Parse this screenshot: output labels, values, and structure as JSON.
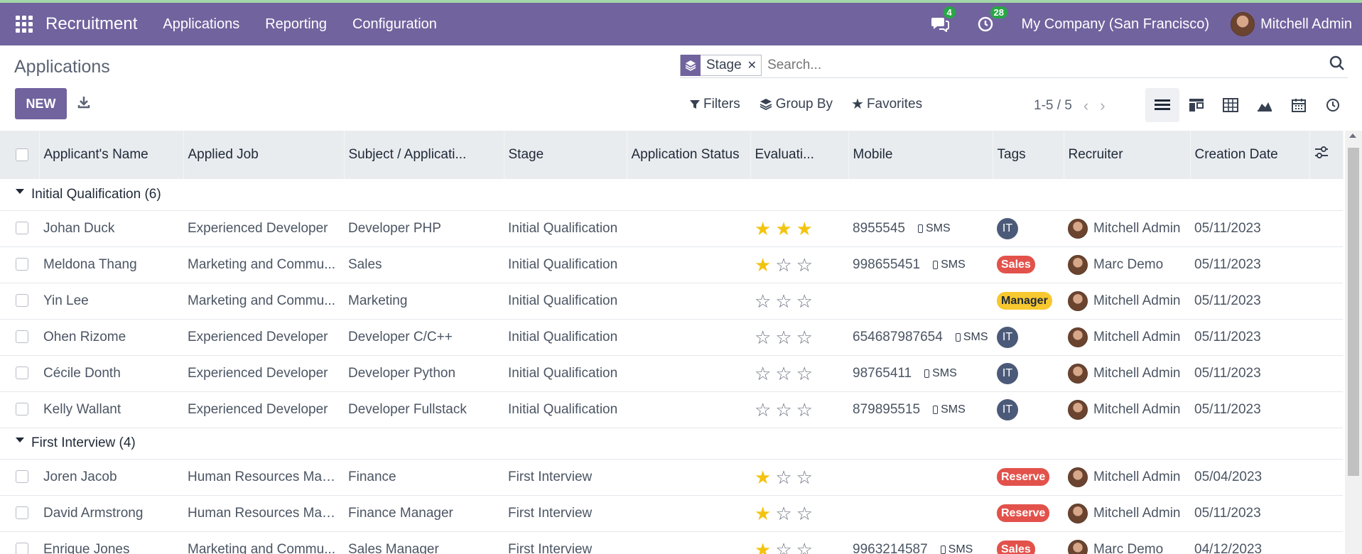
{
  "navbar": {
    "app_title": "Recruitment",
    "menus": [
      "Applications",
      "Reporting",
      "Configuration"
    ],
    "messages_count": "4",
    "activities_count": "28",
    "company": "My Company (San Francisco)",
    "user": "Mitchell Admin",
    "bg_color": "#71639e"
  },
  "control": {
    "title": "Applications",
    "new_label": "NEW",
    "facet_label": "Stage",
    "search_placeholder": "Search...",
    "filters_label": "Filters",
    "groupby_label": "Group By",
    "favorites_label": "Favorites",
    "pager": "1-5 / 5"
  },
  "table": {
    "headers": [
      "Applicant's Name",
      "Applied Job",
      "Subject / Applicati...",
      "Stage",
      "Application Status",
      "Evaluati...",
      "Mobile",
      "Tags",
      "Recruiter",
      "Creation Date"
    ],
    "groups": [
      {
        "label": "Initial Qualification (6)",
        "rows": [
          {
            "name": "Johan Duck",
            "job": "Experienced Developer",
            "subject": "Developer PHP",
            "stage": "Initial Qualification",
            "status": "",
            "stars": 3,
            "mobile": "8955545",
            "sms": "SMS",
            "tag": "IT",
            "tag_type": "it",
            "recruiter": "Mitchell Admin",
            "date": "05/11/2023"
          },
          {
            "name": "Meldona Thang",
            "job": "Marketing and Commu...",
            "subject": "Sales",
            "stage": "Initial Qualification",
            "status": "",
            "stars": 1,
            "mobile": "998655451",
            "sms": "SMS",
            "tag": "Sales",
            "tag_type": "sales",
            "recruiter": "Marc Demo",
            "date": "05/11/2023"
          },
          {
            "name": "Yin Lee",
            "job": "Marketing and Commu...",
            "subject": "Marketing",
            "stage": "Initial Qualification",
            "status": "",
            "stars": 0,
            "mobile": "",
            "sms": "",
            "tag": "Manager",
            "tag_type": "manager",
            "recruiter": "Mitchell Admin",
            "date": "05/11/2023"
          },
          {
            "name": "Ohen Rizome",
            "job": "Experienced Developer",
            "subject": "Developer C/C++",
            "stage": "Initial Qualification",
            "status": "",
            "stars": 0,
            "mobile": "654687987654",
            "sms": "SMS",
            "tag": "IT",
            "tag_type": "it",
            "recruiter": "Mitchell Admin",
            "date": "05/11/2023"
          },
          {
            "name": "Cécile Donth",
            "job": "Experienced Developer",
            "subject": "Developer Python",
            "stage": "Initial Qualification",
            "status": "",
            "stars": 0,
            "mobile": "98765411",
            "sms": "SMS",
            "tag": "IT",
            "tag_type": "it",
            "recruiter": "Mitchell Admin",
            "date": "05/11/2023"
          },
          {
            "name": "Kelly Wallant",
            "job": "Experienced Developer",
            "subject": "Developer Fullstack",
            "stage": "Initial Qualification",
            "status": "",
            "stars": 0,
            "mobile": "879895515",
            "sms": "SMS",
            "tag": "IT",
            "tag_type": "it",
            "recruiter": "Mitchell Admin",
            "date": "05/11/2023"
          }
        ]
      },
      {
        "label": "First Interview (4)",
        "rows": [
          {
            "name": "Joren Jacob",
            "job": "Human Resources Man...",
            "subject": "Finance",
            "stage": "First Interview",
            "status": "",
            "stars": 1,
            "mobile": "",
            "sms": "",
            "tag": "Reserve",
            "tag_type": "reserve",
            "recruiter": "Mitchell Admin",
            "date": "05/04/2023"
          },
          {
            "name": "David Armstrong",
            "job": "Human Resources Man...",
            "subject": "Finance Manager",
            "stage": "First Interview",
            "status": "",
            "stars": 1,
            "mobile": "",
            "sms": "",
            "tag": "Reserve",
            "tag_type": "reserve",
            "recruiter": "Mitchell Admin",
            "date": "05/11/2023"
          },
          {
            "name": "Enrique Jones",
            "job": "Marketing and Commu...",
            "subject": "Sales Manager",
            "stage": "First Interview",
            "status": "",
            "stars": 1,
            "mobile": "9963214587",
            "sms": "SMS",
            "tag": "Sales",
            "tag_type": "sales",
            "recruiter": "Marc Demo",
            "date": "04/12/2023"
          }
        ]
      }
    ]
  }
}
